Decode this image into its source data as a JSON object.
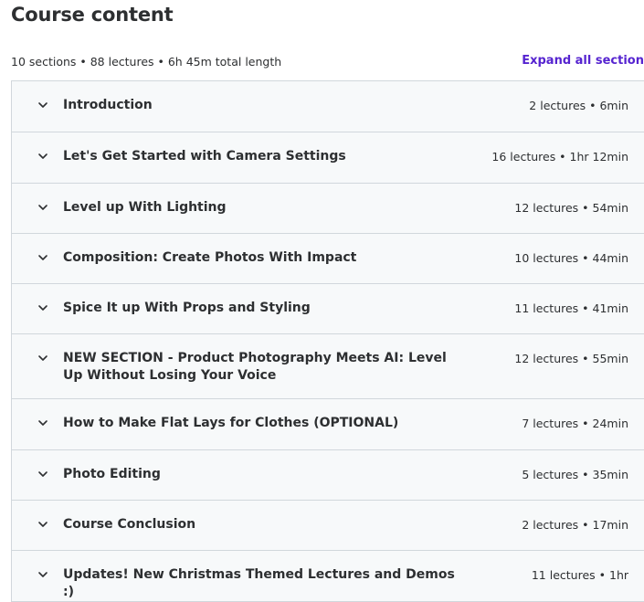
{
  "header": {
    "title": "Course content",
    "summary": "10 sections • 88 lectures • 6h 45m total length",
    "expand_label": "Expand all section"
  },
  "sections": [
    {
      "title": "Introduction",
      "meta": "2 lectures • 6min"
    },
    {
      "title": "Let's Get Started with Camera Settings",
      "meta": "16 lectures • 1hr 12min"
    },
    {
      "title": "Level up With Lighting",
      "meta": "12 lectures • 54min"
    },
    {
      "title": "Composition: Create Photos With Impact",
      "meta": "10 lectures • 44min"
    },
    {
      "title": "Spice It up With Props and Styling",
      "meta": "11 lectures • 41min"
    },
    {
      "title": "NEW SECTION - Product Photography Meets AI: Level Up Without Losing Your Voice",
      "meta": "12 lectures • 55min"
    },
    {
      "title": "How to Make Flat Lays for Clothes (OPTIONAL)",
      "meta": "7 lectures • 24min"
    },
    {
      "title": "Photo Editing",
      "meta": "5 lectures • 35min"
    },
    {
      "title": "Course Conclusion",
      "meta": "2 lectures • 17min"
    },
    {
      "title": "Updates! New Christmas Themed Lectures and Demos :)",
      "meta": "11 lectures • 1hr"
    }
  ]
}
